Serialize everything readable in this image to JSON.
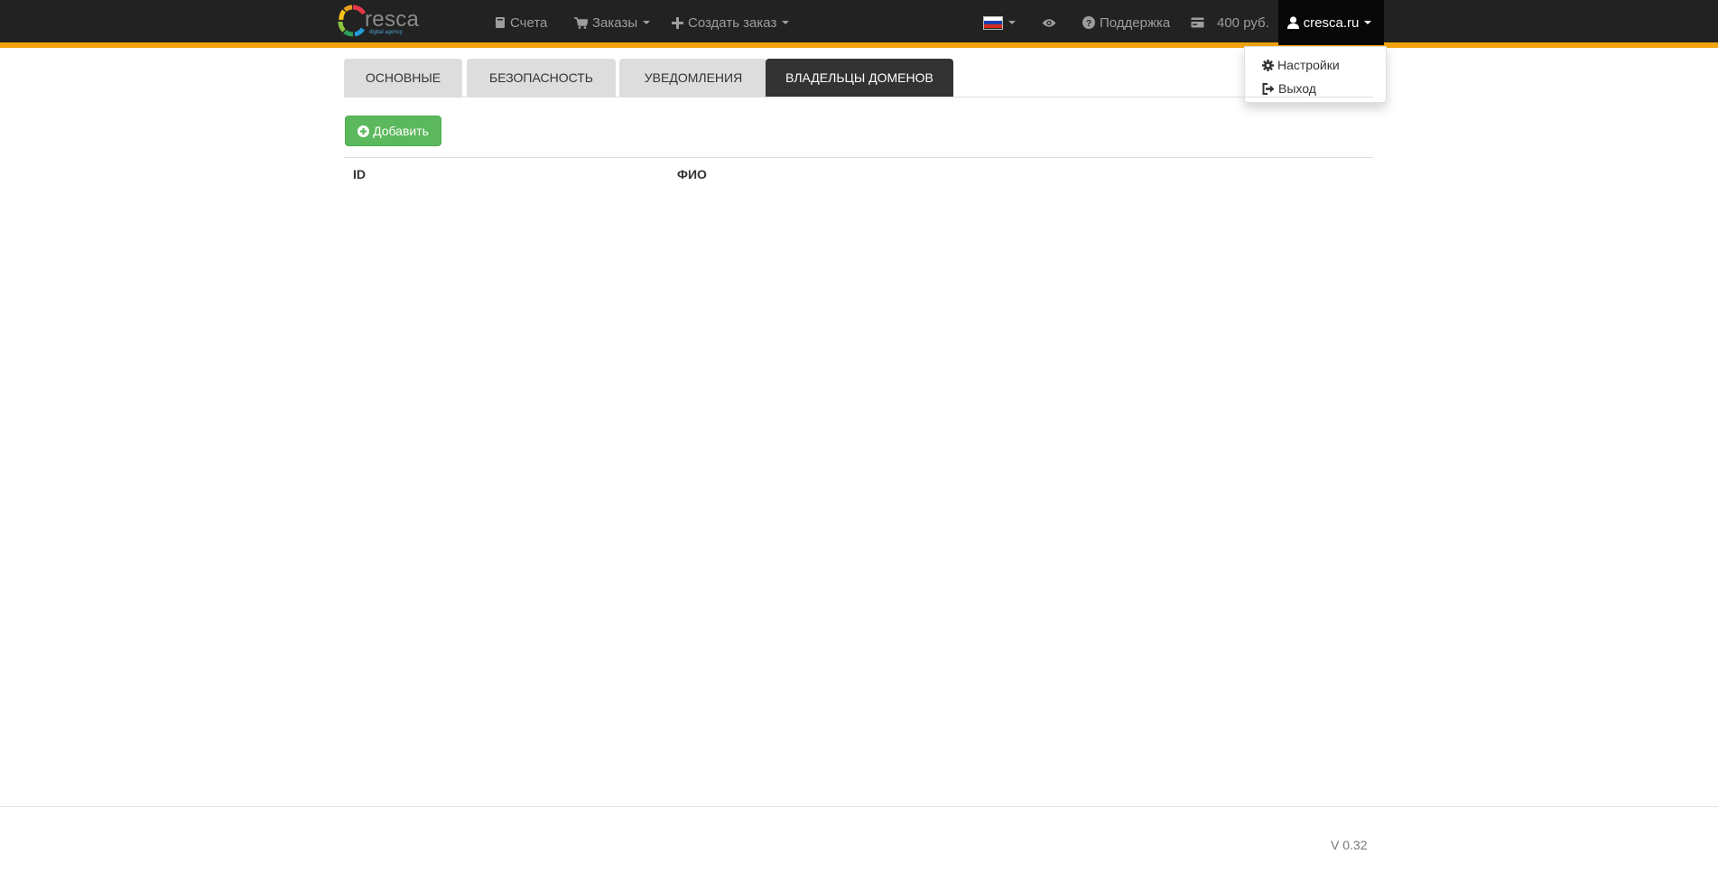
{
  "brand": {
    "name": "resca",
    "tagline": "digital agency"
  },
  "nav": {
    "accounts": "Счета",
    "orders": "Заказы",
    "create_order": "Создать заказ",
    "support": "Поддержка",
    "balance": "400 руб.",
    "user": "cresca.ru"
  },
  "user_menu": {
    "settings": "Настройки",
    "logout": "Выход"
  },
  "tabs": [
    {
      "label": "ОСНОВНЫЕ",
      "active": false
    },
    {
      "label": "БЕЗОПАСНОСТЬ",
      "active": false
    },
    {
      "label": "УВЕДОМЛЕНИЯ",
      "active": false
    },
    {
      "label": "ВЛАДЕЛЬЦЫ ДОМЕНОВ",
      "active": true
    }
  ],
  "add_button": "Добавить",
  "table": {
    "columns": [
      "ID",
      "ФИО"
    ],
    "rows": []
  },
  "footer": {
    "version": "V 0.32"
  },
  "icons": {
    "accounts": "book-icon",
    "orders": "cart-icon",
    "create_order": "plus-icon",
    "language": "russia-flag-icon",
    "preview": "eye-icon",
    "support": "question-circle-icon",
    "balance": "credit-card-icon",
    "user": "user-icon",
    "settings": "gear-icon",
    "logout": "logout-icon",
    "add": "plus-circle-icon"
  },
  "colors": {
    "navbar": "#222222",
    "accent_bar": "#f0a30a",
    "active_tab": "#333333",
    "add_button": "#5cb85c"
  }
}
